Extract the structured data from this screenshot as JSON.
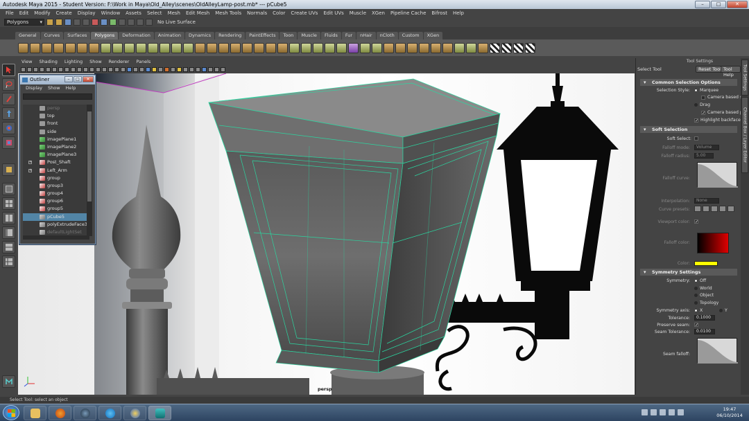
{
  "window": {
    "title": "Autodesk Maya 2015 - Student Version: F:\\Work in Maya\\Old_Alley\\scenes\\OldAlleyLamp-post.mb*   ---   pCube5",
    "minimize": "–",
    "maximize": "□",
    "close": "✕"
  },
  "menubar": [
    "File",
    "Edit",
    "Modify",
    "Create",
    "Display",
    "Window",
    "Assets",
    "Select",
    "Mesh",
    "Edit Mesh",
    "Mesh Tools",
    "Normals",
    "Color",
    "Create UVs",
    "Edit UVs",
    "Muscle",
    "XGen",
    "Pipeline Cache",
    "Bifrost",
    "Help"
  ],
  "statusline": {
    "mode": "Polygons",
    "live_surface": "No Live Surface"
  },
  "shelf_tabs": [
    "General",
    "Curves",
    "Surfaces",
    "Polygons",
    "Deformation",
    "Animation",
    "Dynamics",
    "Rendering",
    "PaintEffects",
    "Toon",
    "Muscle",
    "Fluids",
    "Fur",
    "nHair",
    "nCloth",
    "Custom",
    "XGen"
  ],
  "shelf_active_tab": "Polygons",
  "panel_menu": [
    "View",
    "Shading",
    "Lighting",
    "Show",
    "Renderer",
    "Panels"
  ],
  "viewport": {
    "camera_label": "persp"
  },
  "outliner": {
    "title": "Outliner",
    "menu": [
      "Display",
      "Show",
      "Help"
    ],
    "items": [
      {
        "label": "persp",
        "type": "cam",
        "dim": true
      },
      {
        "label": "top",
        "type": "cam"
      },
      {
        "label": "front",
        "type": "cam"
      },
      {
        "label": "side",
        "type": "cam"
      },
      {
        "label": "imagePlane1",
        "type": "img"
      },
      {
        "label": "imagePlane2",
        "type": "img"
      },
      {
        "label": "imagePlane3",
        "type": "img"
      },
      {
        "label": "Post_Shaft",
        "type": "grp",
        "expand": true
      },
      {
        "label": "Left_Arm",
        "type": "grp",
        "expand": true
      },
      {
        "label": "group",
        "type": "grp"
      },
      {
        "label": "group3",
        "type": "grp"
      },
      {
        "label": "group4",
        "type": "grp"
      },
      {
        "label": "group6",
        "type": "grp"
      },
      {
        "label": "group5",
        "type": "grp"
      },
      {
        "label": "pCube5",
        "type": "mesh",
        "selected": true
      },
      {
        "label": "polyExtrudeFace3Cu",
        "type": "mesh"
      },
      {
        "label": "defaultLightSet",
        "type": "mesh",
        "dim": true
      }
    ]
  },
  "tool_settings": {
    "panel_title": "Tool Settings",
    "tool_name": "Select Tool",
    "reset_button": "Reset Tool",
    "help_button": "Tool Help",
    "common": {
      "header": "Common Selection Options",
      "selection_style_label": "Selection Style:",
      "marquee": "Marquee",
      "camera_based_1": "Camera based se",
      "drag": "Drag",
      "camera_based_2": "Camera based pa",
      "highlight_backfaces": "Highlight backfaces"
    },
    "soft": {
      "header": "Soft Selection",
      "soft_select_label": "Soft Select:",
      "falloff_mode_label": "Falloff mode:",
      "falloff_mode_value": "Volume",
      "falloff_radius_label": "Falloff radius:",
      "falloff_radius_value": "5.00",
      "falloff_curve_label": "Falloff curve:",
      "interpolation_label": "Interpolation:",
      "interpolation_value": "None",
      "curve_presets_label": "Curve presets:",
      "viewport_color_label": "Viewport color:",
      "falloff_color_label": "Falloff color:",
      "color_label": "Color:"
    },
    "symmetry": {
      "header": "Symmetry Settings",
      "symmetry_label": "Symmetry:",
      "options": [
        "Off",
        "World",
        "Object",
        "Topology"
      ],
      "axis_label": "Symmetry axis:",
      "axis_x": "X",
      "axis_y": "Y",
      "tolerance_label": "Tolerance:",
      "tolerance_value": "0.1000",
      "preserve_seam_label": "Preserve seam:",
      "seam_tolerance_label": "Seam Tolerance:",
      "seam_tolerance_value": "0.0100",
      "seam_falloff_label": "Seam falloff:"
    },
    "colors": {
      "highlight": "#ffff00"
    }
  },
  "side_tabs": [
    "Tool Settings",
    "Channel Box / Layer Editor"
  ],
  "helpline": "Select Tool: select an object",
  "taskbar": {
    "time": "19:47",
    "date": "06/10/2014"
  }
}
